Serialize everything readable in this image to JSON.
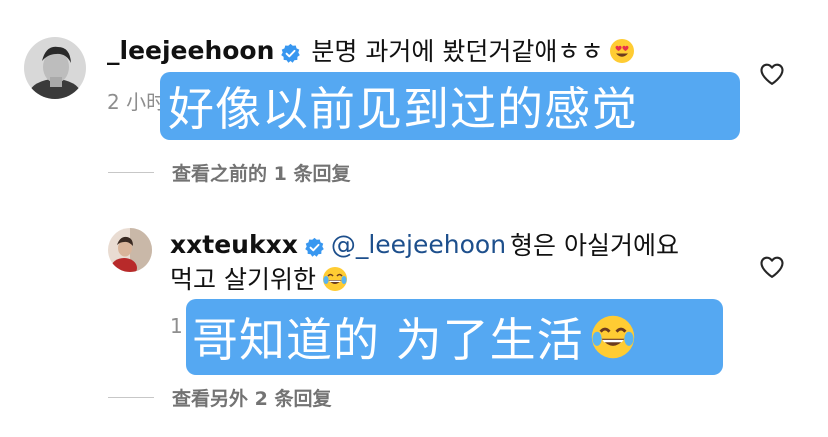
{
  "comments": [
    {
      "username": "_leejeehoon",
      "text": "분명 과거에 봤던거같애ㅎㅎ",
      "emoji_icon": "heart-eyes-emoji",
      "meta": "2 小时",
      "translation": "好像以前见到过的感觉",
      "replies_label": "查看之前的 1 条回复"
    },
    {
      "username": "xxteukxx",
      "mention": "@_leejeehoon",
      "text_line1": "형은 아실거에요",
      "text_line2": "먹고 살기위한",
      "emoji_icon": "tears-of-joy-emoji",
      "meta": "1",
      "translation": "哥知道的 为了生活",
      "replies_label": "查看另外 2 条回复"
    }
  ],
  "colors": {
    "verified": "#3897f0",
    "mention": "#1d4f8c",
    "meta": "#8e8e8e",
    "overlay": "#55a8f2"
  }
}
